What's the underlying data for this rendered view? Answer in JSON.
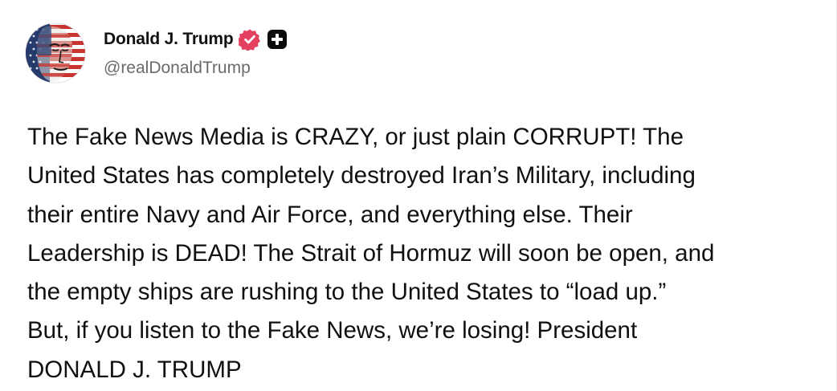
{
  "author": {
    "display_name": "Donald J. Trump",
    "handle": "@realDonaldTrump",
    "avatar_icon": "flag-portrait-avatar",
    "verified_icon": "verified-badge-icon",
    "verified_color": "#e4405f",
    "extra_badge_icon": "plus-badge-icon"
  },
  "post": {
    "body": "The Fake News Media is CRAZY, or just plain CORRUPT! The\nUnited States has completely destroyed Iran’s Military, including\ntheir entire Navy and Air Force, and everything else. Their\nLeadership is DEAD! The Strait of Hormuz will soon be open, and\nthe empty ships are rushing to the United States to “load up.”\nBut, if you listen to the Fake News, we’re losing! President\nDONALD J. TRUMP"
  }
}
